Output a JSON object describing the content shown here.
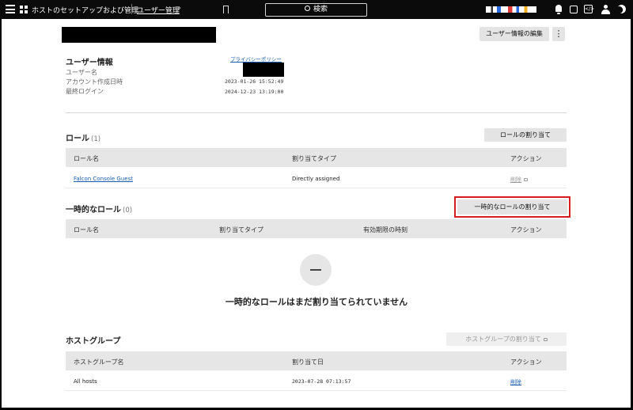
{
  "topbar": {
    "breadcrumb_app": "ホストのセットアップおよび管理",
    "breadcrumb_page": "ユーザー管理",
    "chevron": "›",
    "search_label": "検索",
    "icons": [
      "menu-icon",
      "apps-icon",
      "bookmark-icon",
      "search-icon",
      "bell-icon",
      "list-icon",
      "code-icon",
      "user-icon",
      "moon-icon"
    ]
  },
  "header": {
    "edit_button": "ユーザー情報の編集",
    "more_button": "⋮"
  },
  "user_info": {
    "title": "ユーザー情報",
    "username_label": "ユーザー名",
    "created_label": "アカウント作成日時",
    "last_login_label": "最終ログイン",
    "privacy_link": "プライバシーポリシー",
    "created_value": "2023-01-26 15:52:49",
    "last_login_value": "2024-12-23 13:19:00"
  },
  "roles": {
    "title": "ロール",
    "count": "(1)",
    "assign_button": "ロールの割り当て",
    "columns": [
      "ロール名",
      "割り当てタイプ",
      "アクション"
    ],
    "rows": [
      {
        "name": "Falcon Console Guest",
        "type": "Directly assigned",
        "action": "削除"
      }
    ]
  },
  "temp_roles": {
    "title": "一時的なロール",
    "count": "(0)",
    "assign_button": "一時的なロールの割り当て",
    "columns": [
      "ロール名",
      "割り当てタイプ",
      "有効期限の時刻",
      "アクション"
    ],
    "empty_message": "一時的なロールはまだ割り当てられていません"
  },
  "host_groups": {
    "title": "ホストグループ",
    "assign_button": "ホストグループの割り当て",
    "columns": [
      "ホストグループ名",
      "割り当て日",
      "アクション"
    ],
    "rows": [
      {
        "name": "All hosts",
        "date": "2023-07-28 07:13:57",
        "action": "削除"
      }
    ]
  },
  "colors": {
    "topbar_bg": "#0b0b0b",
    "highlight": "#d61d1d",
    "link": "#1a5fb4"
  }
}
